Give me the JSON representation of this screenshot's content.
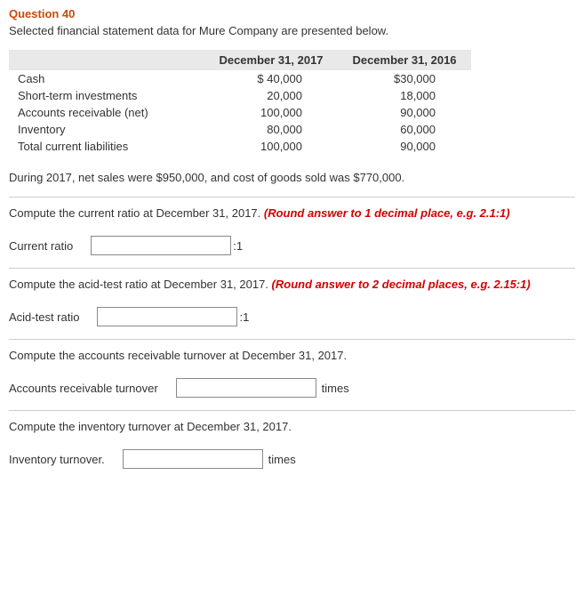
{
  "question": {
    "title": "Question 40",
    "intro": "Selected financial statement data for Mure Company are presented below."
  },
  "table": {
    "headers": {
      "col1": "December 31, 2017",
      "col2": "December 31, 2016"
    },
    "rows": [
      {
        "label": "Cash",
        "v1": "$ 40,000",
        "v2": "$30,000"
      },
      {
        "label": "Short-term investments",
        "v1": "20,000",
        "v2": "18,000"
      },
      {
        "label": "Accounts receivable (net)",
        "v1": "100,000",
        "v2": "90,000"
      },
      {
        "label": "Inventory",
        "v1": "80,000",
        "v2": "60,000"
      },
      {
        "label": "Total current liabilities",
        "v1": "100,000",
        "v2": "90,000"
      }
    ]
  },
  "midtext": "During 2017, net sales were $950,000, and cost of goods sold was $770,000.",
  "parts": {
    "p1": {
      "prompt": "Compute the current ratio at December 31, 2017. ",
      "hint": "(Round answer to 1 decimal place, e.g. 2.1:1)",
      "label": "Current ratio",
      "suffix": ":1"
    },
    "p2": {
      "prompt": "Compute the acid-test ratio at December 31, 2017. ",
      "hint": "(Round answer to 2 decimal places, e.g. 2.15:1)",
      "label": "Acid-test ratio",
      "suffix": ":1"
    },
    "p3": {
      "prompt": "Compute the accounts receivable turnover at December 31, 2017.",
      "label": "Accounts receivable turnover",
      "suffix": "times"
    },
    "p4": {
      "prompt": "Compute the inventory turnover at December 31, 2017.",
      "label": "Inventory turnover.",
      "suffix": "times"
    }
  }
}
